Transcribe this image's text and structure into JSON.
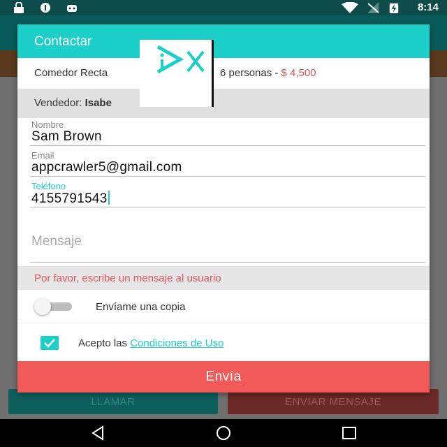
{
  "status_bar": {
    "time": "8:14"
  },
  "background": {
    "call_button": "LLAMAR",
    "send_message_button": "ENVIAR MENSAJE"
  },
  "dialog": {
    "title": "Contactar",
    "product": {
      "name": "Comedor Recta",
      "people": "6 personas - ",
      "price": "$ 4,500"
    },
    "vendor": {
      "label": "Vendedor: ",
      "name": "Isabe"
    },
    "fields": {
      "name": {
        "label": "Nombre",
        "value": "Sam Brown"
      },
      "email": {
        "label": "Email",
        "value": "appcrawler5@gmail.com"
      },
      "phone": {
        "label": "Teléfono",
        "value": "4155791543"
      },
      "message": {
        "placeholder": "Mensaje"
      }
    },
    "error": "Por favor, escribe un mensaje al usuario",
    "copy_toggle": {
      "label": "Envíame una copia",
      "on": false
    },
    "terms": {
      "prefix": "Acepto las ",
      "link": "Condiciones de Uso",
      "checked": true
    },
    "submit": "Envía"
  },
  "colors": {
    "accent": "#1ccfc9",
    "error": "#e05555",
    "submit": "#f25a5a"
  }
}
